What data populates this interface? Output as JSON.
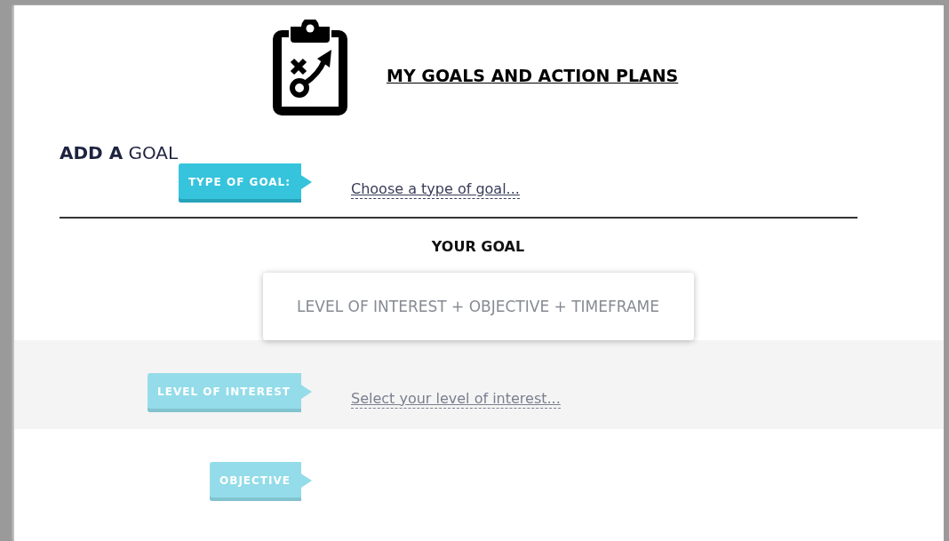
{
  "header": {
    "title": "MY GOALS AND ACTION PLANS"
  },
  "section_heading": "**ADD A** GOAL",
  "type_of_goal": {
    "label": "TYPE OF GOAL:",
    "value": "Choose a type of goal...",
    "disabled": false
  },
  "goal_preview": {
    "heading": "YOUR GOAL",
    "text": "LEVEL OF INTEREST + OBJECTIVE + TIMEFRAME"
  },
  "steps": [
    {
      "label": "LEVEL OF INTEREST",
      "value": "Select your level of interest...",
      "disabled": true,
      "shaded": true
    },
    {
      "label": "OBJECTIVE",
      "disabled": true,
      "shaded": false
    }
  ]
}
